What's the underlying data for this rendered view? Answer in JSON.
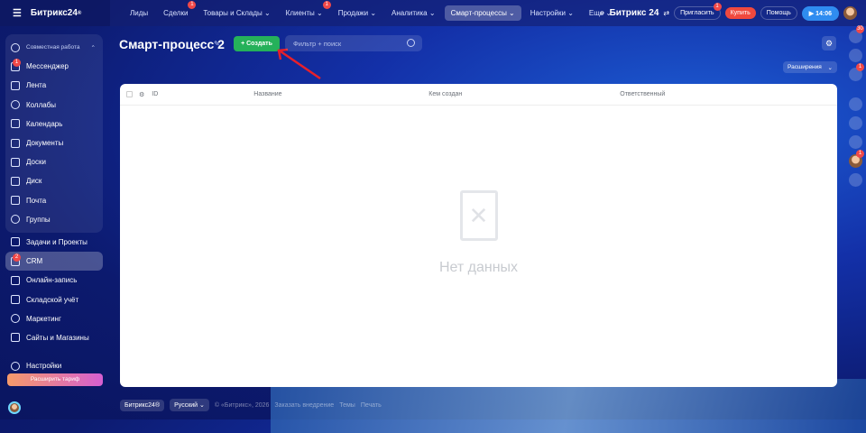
{
  "app": {
    "logo": "Битрикс24",
    "logo_mark": "®"
  },
  "topnav": {
    "items": [
      {
        "label": "Лиды"
      },
      {
        "label": "Сделки",
        "badge": "1"
      },
      {
        "label": "Товары и Склады ⌄"
      },
      {
        "label": "Клиенты ⌄",
        "badge": "1"
      },
      {
        "label": "Продажи ⌄"
      },
      {
        "label": "Аналитика ⌄"
      },
      {
        "label": "Смарт-процессы ⌄",
        "active": true
      },
      {
        "label": "Настройки ⌄"
      },
      {
        "label": "Еще ⌄"
      }
    ]
  },
  "header_right": {
    "brand": "Битрикс 24",
    "invite": "Пригласить",
    "invite_badge": "1",
    "buy": "Купить",
    "help": "Помощь",
    "time": "▶ 14:06"
  },
  "sidebar": {
    "group_title": "Совместная работа",
    "group_items": [
      {
        "label": "Мессенджер",
        "badge": "1"
      },
      {
        "label": "Лента"
      },
      {
        "label": "Коллабы"
      },
      {
        "label": "Календарь"
      },
      {
        "label": "Документы"
      },
      {
        "label": "Доски"
      },
      {
        "label": "Диск"
      },
      {
        "label": "Почта"
      },
      {
        "label": "Группы"
      }
    ],
    "items": [
      {
        "label": "Задачи и Проекты"
      },
      {
        "label": "CRM",
        "badge": "2",
        "active": true
      },
      {
        "label": "Онлайн-запись"
      },
      {
        "label": "Складской учёт"
      },
      {
        "label": "Маркетинг"
      },
      {
        "label": "Сайты и Магазины"
      }
    ],
    "settings": "Настройки",
    "upgrade": "Расширить тариф"
  },
  "page": {
    "title": "Смарт-процесс 2",
    "create": "+ Создать",
    "search_placeholder": "Фильтр + поиск",
    "extensions": "Расширения"
  },
  "table": {
    "columns": [
      "ID",
      "Название",
      "Кем создан",
      "Ответственный"
    ],
    "empty": "Нет данных"
  },
  "right_panel": {
    "notif_badge": "30",
    "chat_badge": "1",
    "avatar_badge": "1"
  },
  "footer": {
    "brand": "Битрикс24®",
    "lang": "Русский ⌄",
    "copyright": "© «Битрикс», 2026",
    "order": "Заказать внедрение",
    "themes": "Темы",
    "print": "Печать"
  }
}
